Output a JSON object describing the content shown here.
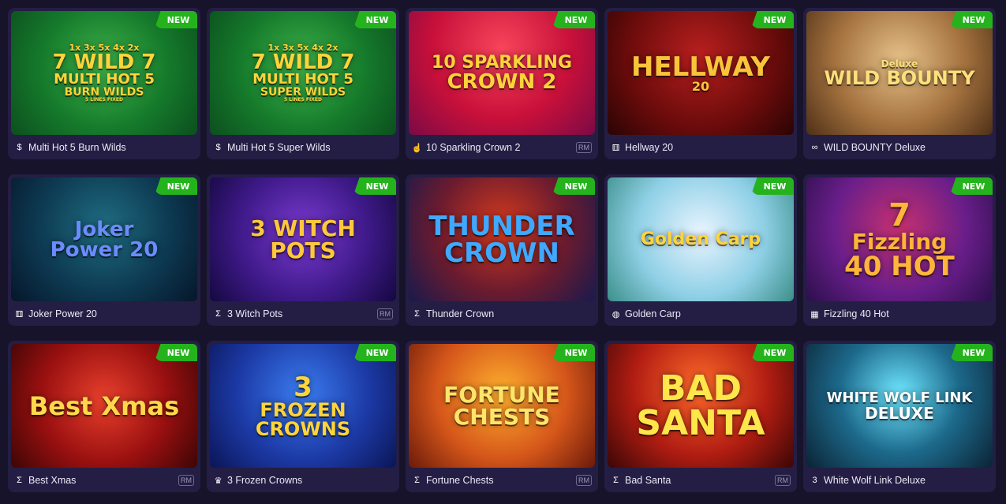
{
  "badge_label": "NEW",
  "rm_label": "RM",
  "colors": {
    "background": "#17132b",
    "card": "#241e44",
    "badge": "#25b31d"
  },
  "games": [
    {
      "title": "Multi Hot 5 Burn Wilds",
      "provider_icon": "dollar-coin-icon",
      "glyph": "$",
      "rm": false,
      "logo_lines": [
        "1x 3x 5x 4x 2x",
        "7 WILD 7",
        "MULTI HOT 5",
        "BURN WILDS",
        "5 LINES FIXED"
      ],
      "bg": "radial-gradient(circle at 50% 45%, #3fb24a, #157a2b 55%, #0c4f1e)",
      "color": "#ffd43a"
    },
    {
      "title": "Multi Hot 5 Super Wilds",
      "provider_icon": "dollar-coin-icon",
      "glyph": "$",
      "rm": false,
      "logo_lines": [
        "1x 3x 5x 4x 2x",
        "7 WILD 7",
        "MULTI HOT 5",
        "SUPER WILDS",
        "5 LINES FIXED"
      ],
      "bg": "radial-gradient(circle at 50% 45%, #3fb24a, #157a2b 55%, #0c4f1e)",
      "color": "#ffd43a"
    },
    {
      "title": "10 Sparkling Crown 2",
      "provider_icon": "hand-icon",
      "glyph": "☝",
      "rm": true,
      "logo_lines": [
        "10 SPARKLING",
        "CROWN 2"
      ],
      "bg": "radial-gradient(circle at 50% 30%, #f7455a, #c8103a 55%, #7b0a45)",
      "color": "#ffd23a"
    },
    {
      "title": "Hellway 20",
      "provider_icon": "dice-icon",
      "glyph": "⚅",
      "rm": false,
      "logo_lines": [
        "HELLWAY",
        "20"
      ],
      "bg": "radial-gradient(circle at 50% 35%, #b81f1f, #6a0b0b 60%, #2a0404)",
      "color": "#f8c43a"
    },
    {
      "title": "WILD BOUNTY Deluxe",
      "provider_icon": "infinity-icon",
      "glyph": "∞",
      "rm": false,
      "logo_lines": [
        "Deluxe",
        "WILD BOUNTY"
      ],
      "bg": "radial-gradient(circle at 50% 40%, #e7c28a, #a3713e 55%, #4e3017)",
      "color": "#fde07a"
    },
    {
      "title": "Joker Power 20",
      "provider_icon": "dice-icon",
      "glyph": "⚅",
      "rm": false,
      "logo_lines": [
        "Joker",
        "Power 20"
      ],
      "bg": "radial-gradient(circle at 50% 40%, #1f6d82, #0d3a52 55%, #06162a)",
      "color": "#6b8cff"
    },
    {
      "title": "3 Witch Pots",
      "provider_icon": "sigma-icon",
      "glyph": "Σ",
      "rm": true,
      "logo_lines": [
        "3 WITCH",
        "POTS"
      ],
      "bg": "radial-gradient(circle at 50% 45%, #7b3ad1, #3f1a8a 55%, #150840)",
      "color": "#ffc83a"
    },
    {
      "title": "Thunder Crown",
      "provider_icon": "sigma-icon",
      "glyph": "Σ",
      "rm": false,
      "logo_lines": [
        "THUNDER",
        "CROWN"
      ],
      "bg": "radial-gradient(circle at 50% 40%, #d53a1c, #6b1b2f 55%, #181a4d)",
      "color": "#3fa8ff"
    },
    {
      "title": "Golden Carp",
      "provider_icon": "globe-icon",
      "glyph": "◍",
      "rm": false,
      "logo_lines": [
        "Golden Carp"
      ],
      "bg": "radial-gradient(circle at 50% 45%, #e9f4ff, #8fd0e6 55%, #3c8f8a)",
      "color": "#ffd43a"
    },
    {
      "title": "Fizzling 40 Hot",
      "provider_icon": "slot-icon",
      "glyph": "▦",
      "rm": false,
      "logo_lines": [
        "7",
        "Fizzling",
        "40 HOT"
      ],
      "bg": "radial-gradient(circle at 50% 40%, #c7306f, #6a1e8a 55%, #2b0f4b)",
      "color": "#ffb43a"
    },
    {
      "title": "Best Xmas",
      "provider_icon": "sigma-icon",
      "glyph": "Σ",
      "rm": true,
      "logo_lines": [
        "Best Xmas"
      ],
      "bg": "radial-gradient(circle at 50% 45%, #e8402c, #9a1010 55%, #3d0505)",
      "color": "#ffd94a"
    },
    {
      "title": "3 Frozen Crowns",
      "provider_icon": "crown-icon",
      "glyph": "♛",
      "rm": false,
      "logo_lines": [
        "3",
        "FROZEN",
        "CROWNS"
      ],
      "bg": "radial-gradient(circle at 50% 40%, #3b7cf0, #1c3aa6 55%, #0b1556)",
      "color": "#ffd43a"
    },
    {
      "title": "Fortune Chests",
      "provider_icon": "sigma-icon",
      "glyph": "Σ",
      "rm": true,
      "logo_lines": [
        "FORTUNE",
        "CHESTS"
      ],
      "bg": "radial-gradient(circle at 50% 40%, #ffb02e, #d5561a 55%, #6b1a0a)",
      "color": "#ffe56a"
    },
    {
      "title": "Bad Santa",
      "provider_icon": "sigma-icon",
      "glyph": "Σ",
      "rm": true,
      "logo_lines": [
        "BAD",
        "SANTA"
      ],
      "bg": "radial-gradient(circle at 50% 35%, #ff6a2a, #b11d12 55%, #3a0606)",
      "color": "#ffe64a"
    },
    {
      "title": "White Wolf Link Deluxe",
      "provider_icon": "three-icon",
      "glyph": "3",
      "rm": false,
      "logo_lines": [
        "WHITE WOLF LINK",
        "DELUXE"
      ],
      "bg": "radial-gradient(circle at 50% 40%, #6fe7ff, #1d6a8c 50%, #0b2334)",
      "color": "#ffffff"
    }
  ]
}
